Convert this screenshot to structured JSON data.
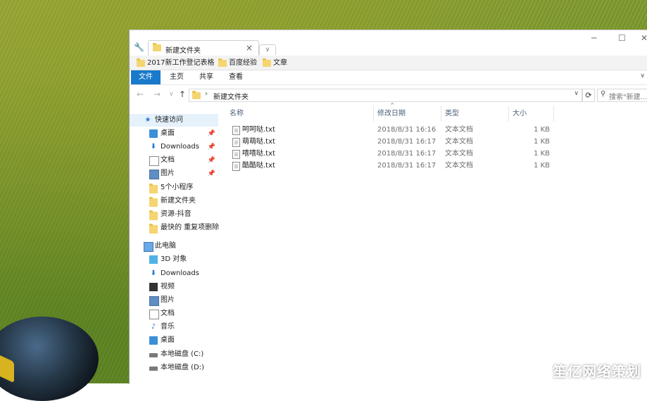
{
  "window": {
    "tab_label": "新建文件夹",
    "minimize": "─",
    "maximize": "☐",
    "close": "✕"
  },
  "bookmarks": [
    "2017新工作登记表格",
    "百度经验",
    "文章"
  ],
  "ribbon": {
    "tabs": [
      "文件",
      "主页",
      "共享",
      "查看"
    ],
    "active": "文件"
  },
  "address": {
    "back": "←",
    "forward": "→",
    "recent": "∨",
    "up": "↑",
    "separator": "›",
    "path": "新建文件夹",
    "search_placeholder": "搜索\"新建..."
  },
  "sidebar": {
    "quick_access": {
      "label": "快速访问",
      "items": [
        {
          "label": "桌面",
          "icon": "desktop-icon",
          "pinned": true
        },
        {
          "label": "Downloads",
          "icon": "download-icon",
          "pinned": true
        },
        {
          "label": "文档",
          "icon": "document-icon",
          "pinned": true
        },
        {
          "label": "图片",
          "icon": "pictures-icon",
          "pinned": true
        },
        {
          "label": "5个小程序",
          "icon": "folder-icon",
          "pinned": false
        },
        {
          "label": "新建文件夹",
          "icon": "folder-icon",
          "pinned": false
        },
        {
          "label": "资源-抖音",
          "icon": "folder-icon",
          "pinned": false
        },
        {
          "label": "最快的 重复项删除",
          "icon": "folder-icon",
          "pinned": false
        }
      ]
    },
    "this_pc": {
      "label": "此电脑",
      "items": [
        {
          "label": "3D 对象",
          "icon": "3d-objects-icon"
        },
        {
          "label": "Downloads",
          "icon": "download-icon"
        },
        {
          "label": "视频",
          "icon": "video-icon"
        },
        {
          "label": "图片",
          "icon": "pictures-icon"
        },
        {
          "label": "文档",
          "icon": "document-icon"
        },
        {
          "label": "音乐",
          "icon": "music-icon"
        },
        {
          "label": "桌面",
          "icon": "desktop-icon"
        },
        {
          "label": "本地磁盘 (C:)",
          "icon": "disk-icon"
        },
        {
          "label": "本地磁盘 (D:)",
          "icon": "disk-icon"
        }
      ]
    }
  },
  "columns": {
    "name": "名称",
    "date": "修改日期",
    "type": "类型",
    "size": "大小"
  },
  "files": [
    {
      "name": "呵呵哒.txt",
      "date": "2018/8/31 16:16",
      "type": "文本文档",
      "size": "1 KB"
    },
    {
      "name": "萌萌哒.txt",
      "date": "2018/8/31 16:17",
      "type": "文本文档",
      "size": "1 KB"
    },
    {
      "name": "嘻嘻哒.txt",
      "date": "2018/8/31 16:17",
      "type": "文本文档",
      "size": "1 KB"
    },
    {
      "name": "酷酷哒.txt",
      "date": "2018/8/31 16:17",
      "type": "文本文档",
      "size": "1 KB"
    }
  ],
  "watermark": "笙亿网络策划"
}
